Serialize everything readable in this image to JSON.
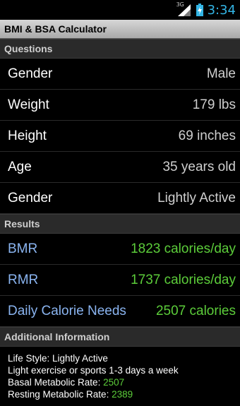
{
  "status": {
    "network": "3G",
    "time": "3:34"
  },
  "app": {
    "title": "BMI & BSA Calculator"
  },
  "questions": {
    "header": "Questions",
    "rows": [
      {
        "label": "Gender",
        "value": "Male"
      },
      {
        "label": "Weight",
        "value": "179 lbs"
      },
      {
        "label": "Height",
        "value": "69 inches"
      },
      {
        "label": "Age",
        "value": "35 years old"
      },
      {
        "label": "Gender",
        "value": "Lightly Active"
      }
    ]
  },
  "results": {
    "header": "Results",
    "rows": [
      {
        "label": "BMR",
        "value": "1823 calories/day"
      },
      {
        "label": "RMR",
        "value": "1737 calories/day"
      },
      {
        "label": "Daily Calorie Needs",
        "value": "2507 calories"
      }
    ]
  },
  "additional": {
    "header": "Additional Information",
    "lifestyle": "Life Style: Lightly Active",
    "exercise": "Light exercise or sports 1-3 days a week",
    "basal_label": "Basal Metabolic Rate: ",
    "basal_value": "2507",
    "resting_label": "Resting Metabolic Rate: ",
    "resting_value": "2389"
  },
  "colors": {
    "clock": "#33b5e5",
    "result_label": "#8ab4f0",
    "result_value": "#5ccd3a"
  }
}
